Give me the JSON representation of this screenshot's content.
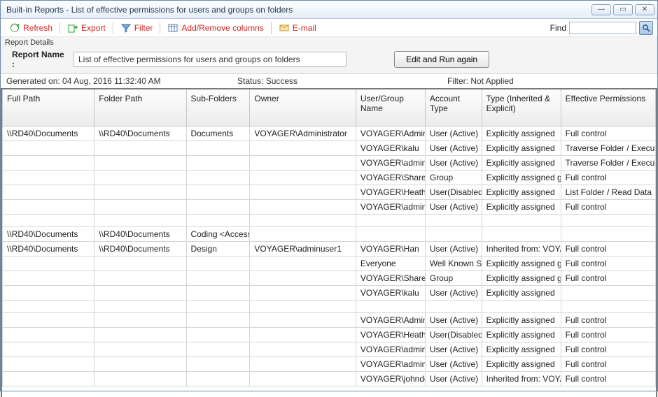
{
  "window": {
    "title": "Built-in Reports - List of effective permissions for users and groups on folders"
  },
  "toolbar": {
    "refresh": "Refresh",
    "export": "Export",
    "filter": "Filter",
    "columns": "Add/Remove columns",
    "email": "E-mail",
    "find_label": "Find",
    "find_value": ""
  },
  "details": {
    "header": "Report Details",
    "name_label": "Report Name :",
    "name_value": "List of effective permissions for users and groups on folders",
    "edit_btn": "Edit and Run again"
  },
  "status": {
    "generated": "Generated on: 04 Aug, 2016 11:32:40 AM",
    "status": "Status: Success",
    "filter": "Filter: Not Applied"
  },
  "columns": [
    "Full Path",
    "Folder Path",
    "Sub-Folders",
    "Owner",
    "User/Group Name",
    "Account Type",
    "Type (Inherited & Explicit)",
    "Effective Permissions"
  ],
  "rows": [
    [
      "\\\\RD40\\Documents",
      "\\\\RD40\\Documents",
      "Documents",
      "VOYAGER\\Administrator",
      "VOYAGER\\Administ",
      "User (Active)",
      "Explicitly assigned",
      "Full control"
    ],
    [
      "",
      "",
      "",
      "",
      "VOYAGER\\kalu",
      "User (Active)",
      "Explicitly assigned",
      "Traverse Folder / Execute File"
    ],
    [
      "",
      "",
      "",
      "",
      "VOYAGER\\adminus",
      "User (Active)",
      "Explicitly assigned",
      "Traverse Folder / Execute File"
    ],
    [
      "",
      "",
      "",
      "",
      "VOYAGER\\SharePo",
      "Group",
      "Explicitly assigned group",
      "Full control"
    ],
    [
      "",
      "",
      "",
      "",
      "VOYAGER\\Heath",
      "User(Disabled)",
      "Explicitly assigned",
      "List Folder / Read Data"
    ],
    [
      "",
      "",
      "",
      "",
      "VOYAGER\\adminus",
      "User (Active)",
      "Explicitly assigned",
      "Full control"
    ],
    [
      "",
      "",
      "",
      "",
      "",
      "",
      "",
      ""
    ],
    [
      "\\\\RD40\\Documents",
      "\\\\RD40\\Documents",
      "Coding <Access",
      "",
      "",
      "",
      "",
      ""
    ],
    [
      "\\\\RD40\\Documents",
      "\\\\RD40\\Documents",
      "Design",
      "VOYAGER\\adminuser1",
      "VOYAGER\\Han",
      "User (Active)",
      "Inherited from: VOYAGER\\",
      "Full control"
    ],
    [
      "",
      "",
      "",
      "",
      "Everyone",
      "Well Known Sid",
      "Explicitly assigned group",
      "Full control"
    ],
    [
      "",
      "",
      "",
      "",
      "VOYAGER\\SharePo",
      "Group",
      "Explicitly assigned group",
      "Full control"
    ],
    [
      "",
      "",
      "",
      "",
      "VOYAGER\\kalu",
      "User (Active)",
      "Explicitly assigned",
      ""
    ],
    [
      "",
      "",
      "",
      "",
      "",
      "",
      "",
      ""
    ],
    [
      "",
      "",
      "",
      "",
      "VOYAGER\\Administ",
      "User (Active)",
      "Explicitly assigned",
      "Full control"
    ],
    [
      "",
      "",
      "",
      "",
      "VOYAGER\\Heath",
      "User(Disabled)",
      "Explicitly assigned",
      "Full control"
    ],
    [
      "",
      "",
      "",
      "",
      "VOYAGER\\adminus",
      "User (Active)",
      "Explicitly assigned",
      "Full control"
    ],
    [
      "",
      "",
      "",
      "",
      "VOYAGER\\adminus",
      "User (Active)",
      "Explicitly assigned",
      "Full control"
    ],
    [
      "",
      "",
      "",
      "",
      "VOYAGER\\johndoe",
      "User (Active)",
      "Inherited from: VOYAGER\\",
      "Full control"
    ]
  ]
}
